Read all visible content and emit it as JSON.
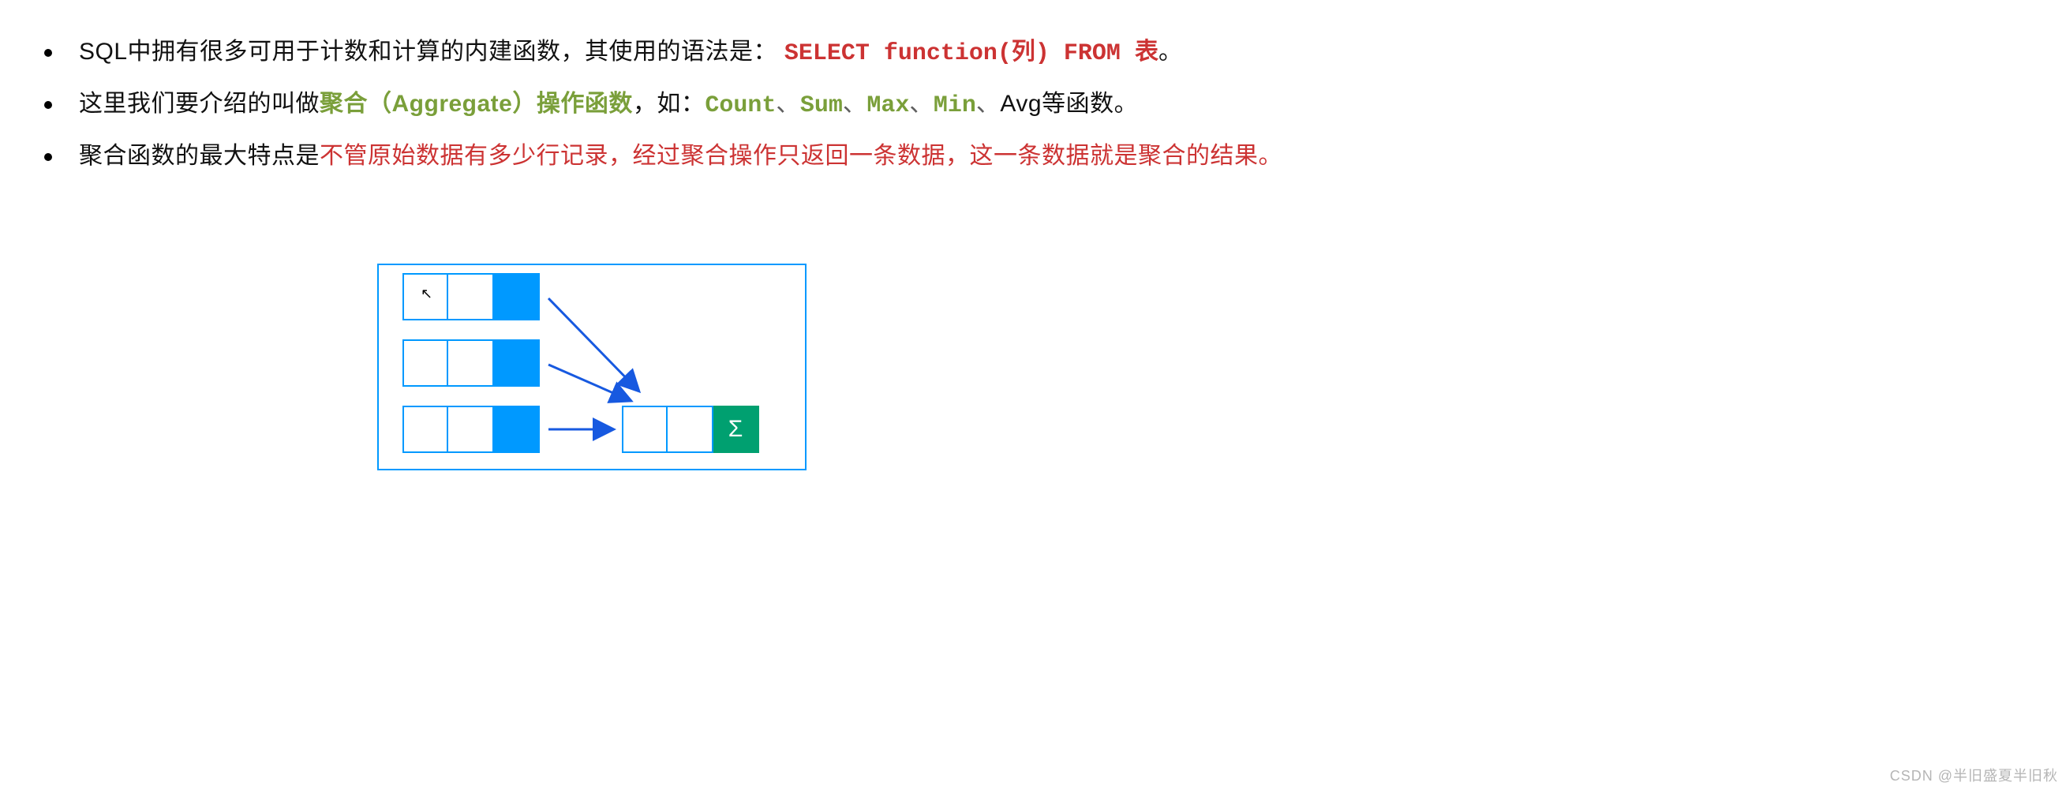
{
  "bullets": {
    "b1": {
      "t1": "SQL中拥有很多可用于计数和计算的内建函数，其使用的语法是：",
      "t2": "SELECT function(",
      "t3": "列",
      "t4": ") FROM ",
      "t5": "表",
      "t6": "。"
    },
    "b2": {
      "t1": "这里我们要介绍的叫做",
      "t2": "聚合（Aggregate）操作函数",
      "t3": "，如：",
      "t4": "Count",
      "s1": "、",
      "t5": "Sum",
      "s2": "、",
      "t6": "Max",
      "s3": "、",
      "t7": "Min",
      "s4": "、",
      "t8": "Avg等函数。"
    },
    "b3": {
      "t1": "聚合函数的最大特点是",
      "t2": "不管原始数据有多少行记录，经过聚合操作只返回一条数据，这一条数据就是聚合的结果。"
    }
  },
  "diagram": {
    "sigma": "Σ",
    "cursor": "↖"
  },
  "watermark": "CSDN @半旧盛夏半旧秋"
}
